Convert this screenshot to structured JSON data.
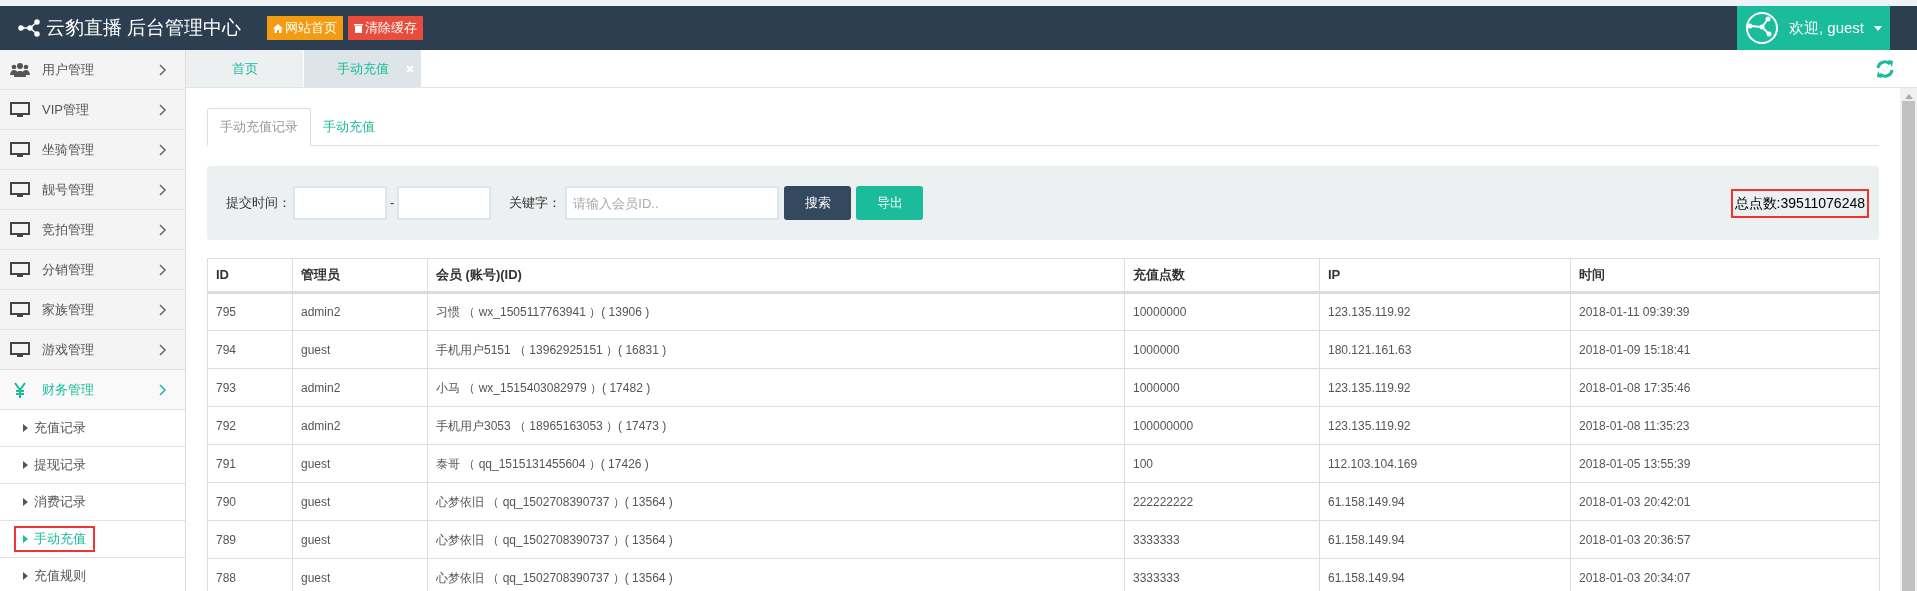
{
  "header": {
    "title": "云豹直播 后台管理中心",
    "buttons": [
      {
        "label": "网站首页",
        "kind": "home"
      },
      {
        "label": "清除缓存",
        "kind": "clear"
      }
    ],
    "user": "欢迎, guest"
  },
  "sidebar": {
    "items": [
      {
        "label": "用户管理",
        "expanded": false
      },
      {
        "label": "VIP管理",
        "expanded": false
      },
      {
        "label": "坐骑管理",
        "expanded": false
      },
      {
        "label": "靓号管理",
        "expanded": false
      },
      {
        "label": "竞拍管理",
        "expanded": false
      },
      {
        "label": "分销管理",
        "expanded": false
      },
      {
        "label": "家族管理",
        "expanded": false
      },
      {
        "label": "游戏管理",
        "expanded": false
      },
      {
        "label": "财务管理",
        "expanded": true,
        "children": [
          {
            "label": "充值记录",
            "selected": false,
            "highlighted": false
          },
          {
            "label": "提现记录",
            "selected": false,
            "highlighted": false
          },
          {
            "label": "消费记录",
            "selected": false,
            "highlighted": false
          },
          {
            "label": "手动充值",
            "selected": true,
            "highlighted": true
          },
          {
            "label": "充值规则",
            "selected": false,
            "highlighted": false
          }
        ]
      }
    ]
  },
  "page_tabs": [
    {
      "label": "首页",
      "selected": false,
      "closable": false
    },
    {
      "label": "手动充值",
      "selected": true,
      "closable": true
    }
  ],
  "inner_tabs": [
    {
      "label": "手动充值记录",
      "selected": true
    },
    {
      "label": "手动充值",
      "selected": false
    }
  ],
  "filter": {
    "time_label": "提交时间：",
    "separator": "-",
    "keyword_label": "关键字：",
    "keyword_placeholder": "请输入会员ID..",
    "search_button": "搜索",
    "export_button": "导出",
    "total": "总点数:39511076248",
    "total_highlighted": true
  },
  "table": {
    "columns": [
      "ID",
      "管理员",
      "会员 (账号)(ID)",
      "充值点数",
      "IP",
      "时间"
    ],
    "rows": [
      [
        "795",
        "admin2",
        "习惯 （ wx_1505117763941 ）( 13906 )",
        "10000000",
        "123.135.119.92",
        "2018-01-11 09:39:39"
      ],
      [
        "794",
        "guest",
        "手机用户5151 （ 13962925151 ）( 16831 )",
        "1000000",
        "180.121.161.63",
        "2018-01-09 15:18:41"
      ],
      [
        "793",
        "admin2",
        "小马 （ wx_1515403082979 ）( 17482 )",
        "1000000",
        "123.135.119.92",
        "2018-01-08 17:35:46"
      ],
      [
        "792",
        "admin2",
        "手机用户3053 （ 18965163053 ）( 17473 )",
        "100000000",
        "123.135.119.92",
        "2018-01-08 11:35:23"
      ],
      [
        "791",
        "guest",
        "泰哥 （ qq_1515131455604 ）( 17426 )",
        "100",
        "112.103.104.169",
        "2018-01-05 13:55:39"
      ],
      [
        "790",
        "guest",
        "心梦依旧 （ qq_1502708390737 ）( 13564 )",
        "222222222",
        "61.158.149.94",
        "2018-01-03 20:42:01"
      ],
      [
        "789",
        "guest",
        "心梦依旧 （ qq_1502708390737 ）( 13564 )",
        "3333333",
        "61.158.149.94",
        "2018-01-03 20:36:57"
      ],
      [
        "788",
        "guest",
        "心梦依旧 （ qq_1502708390737 ）( 13564 )",
        "3333333",
        "61.158.149.94",
        "2018-01-03 20:34:07"
      ]
    ]
  }
}
